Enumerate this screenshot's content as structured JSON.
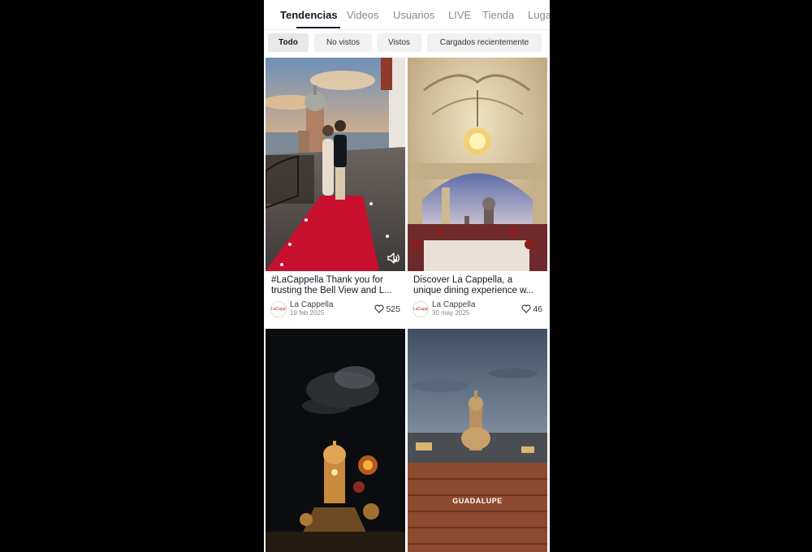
{
  "tabs": [
    {
      "label": "Tendencias",
      "active": true
    },
    {
      "label": "Videos"
    },
    {
      "label": "Usuarios"
    },
    {
      "label": "LIVE"
    },
    {
      "label": "Tienda"
    },
    {
      "label": "Lugares"
    }
  ],
  "filters": [
    {
      "label": "Todo",
      "active": true
    },
    {
      "label": "No vistos"
    },
    {
      "label": "Vistos"
    },
    {
      "label": "Cargados recientemente"
    }
  ],
  "videos": [
    {
      "caption_line1": "#LaCappella  Thank you for",
      "caption_line2": "trusting the Bell View and L...",
      "author": "La Cappella",
      "date": "19 feb 2025",
      "likes": "525",
      "avatar_text": "LaCappella",
      "has_sound_icon": true
    },
    {
      "caption_line1": "Discover La Cappella, a",
      "caption_line2": "unique dining experience w...",
      "author": "La Cappella",
      "date": "30 may 2025",
      "likes": "46",
      "avatar_text": "LaCappella"
    },
    {
      "overlay_text": ""
    },
    {
      "overlay_text": "GUADALUPE"
    }
  ],
  "colors": {
    "accent": "#161823",
    "carpet": "#c8102e"
  }
}
